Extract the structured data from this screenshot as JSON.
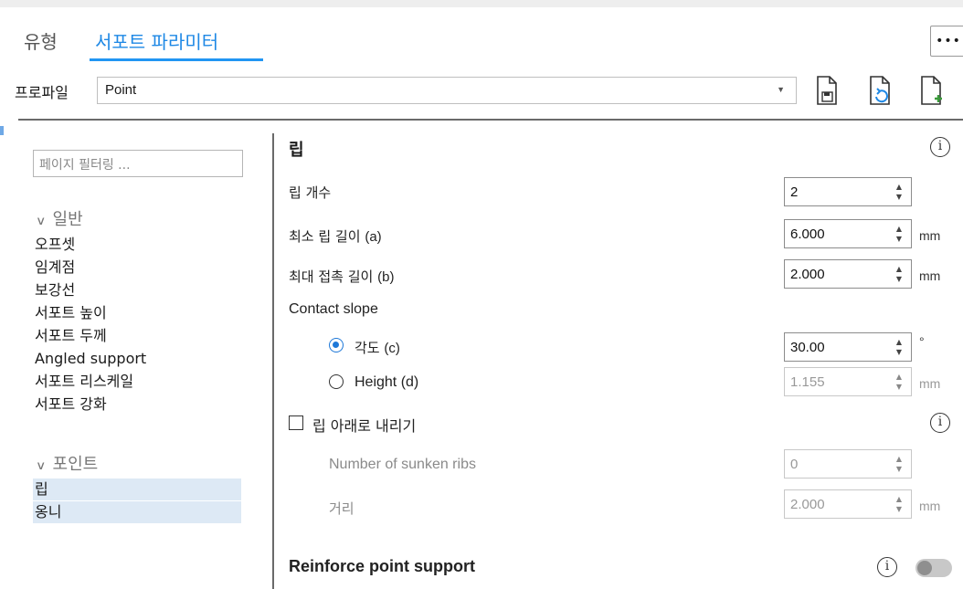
{
  "tabs": [
    {
      "label": "유형",
      "active": false
    },
    {
      "label": "서포트 파라미터",
      "active": true
    }
  ],
  "more_button": "•••",
  "profile": {
    "label": "프로파일",
    "value": "Point",
    "icons": [
      "file-save-icon",
      "file-refresh-icon",
      "file-add-icon"
    ]
  },
  "left_panel": {
    "filter_placeholder": "페이지 필터링 ...",
    "groups": [
      {
        "label": "일반",
        "items": [
          "오프셋",
          "임계점",
          "보강선",
          "서포트 높이",
          "서포트 두께",
          "Angled support",
          "서포트 리스케일",
          "서포트 강화"
        ]
      },
      {
        "label": "포인트",
        "items": [
          "립",
          "옹니"
        ],
        "selected": [
          "립",
          "옹니"
        ]
      }
    ]
  },
  "main": {
    "section_title": "립",
    "rib_count": {
      "label": "립 개수",
      "value": "2"
    },
    "min_rib_length": {
      "label": "최소 립 길이",
      "suffix": "(a)",
      "value": "6.000",
      "unit": "mm"
    },
    "max_contact_length": {
      "label": "최대 접촉 길이",
      "suffix": "(b)",
      "value": "2.000",
      "unit": "mm"
    },
    "contact_slope": {
      "label": "Contact slope"
    },
    "angle": {
      "label": "각도",
      "suffix": "(c)",
      "value": "30.00",
      "unit": "°",
      "selected": true
    },
    "height": {
      "label": "Height (d)",
      "value": "1.155",
      "unit": "mm",
      "selected": false
    },
    "lower_ribs": {
      "label": "립 아래로 내리기",
      "checked": false
    },
    "sunken_ribs": {
      "label": "Number of sunken ribs",
      "value": "0"
    },
    "distance": {
      "label": "거리",
      "value": "2.000",
      "unit": "mm"
    },
    "reinforce": {
      "label": "Reinforce point support",
      "enabled": false
    }
  }
}
